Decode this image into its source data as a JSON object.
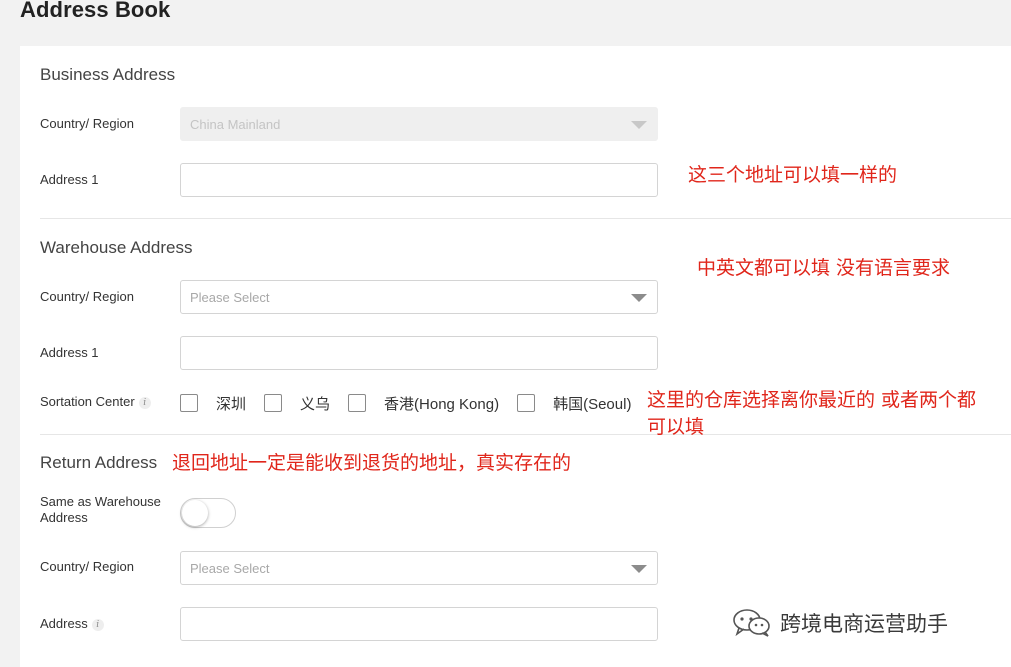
{
  "page": {
    "title": "Address Book"
  },
  "business": {
    "title": "Business Address",
    "country_label": "Country/ Region",
    "country_value": "China Mainland",
    "address1_label": "Address 1",
    "address1_value": ""
  },
  "warehouse": {
    "title": "Warehouse Address",
    "country_label": "Country/ Region",
    "country_placeholder": "Please Select",
    "address1_label": "Address 1",
    "address1_value": "",
    "sortation_label": "Sortation Center",
    "sortation_options": [
      {
        "label": "深圳",
        "checked": false
      },
      {
        "label": "义乌",
        "checked": false
      },
      {
        "label": "香港(Hong Kong)",
        "checked": false
      },
      {
        "label": "韩国(Seoul)",
        "checked": false
      }
    ]
  },
  "return": {
    "title": "Return Address",
    "same_label": "Same as Warehouse Address",
    "same_toggle": false,
    "country_label": "Country/ Region",
    "country_placeholder": "Please Select",
    "address_label": "Address",
    "address_value": ""
  },
  "annotations": {
    "a1": "这三个地址可以填一样的",
    "a2": "中英文都可以填 没有语言要求",
    "a3_line1": "这里的仓库选择离你最近的 或者两个都",
    "a3_line2": "可以填",
    "a4": "退回地址一定是能收到退货的地址，真实存在的"
  },
  "watermark": {
    "text": "跨境电商运营助手",
    "icon": "wechat-icon"
  },
  "colors": {
    "annotation": "#e0261b",
    "background": "#f2f2f2",
    "card": "#ffffff"
  }
}
